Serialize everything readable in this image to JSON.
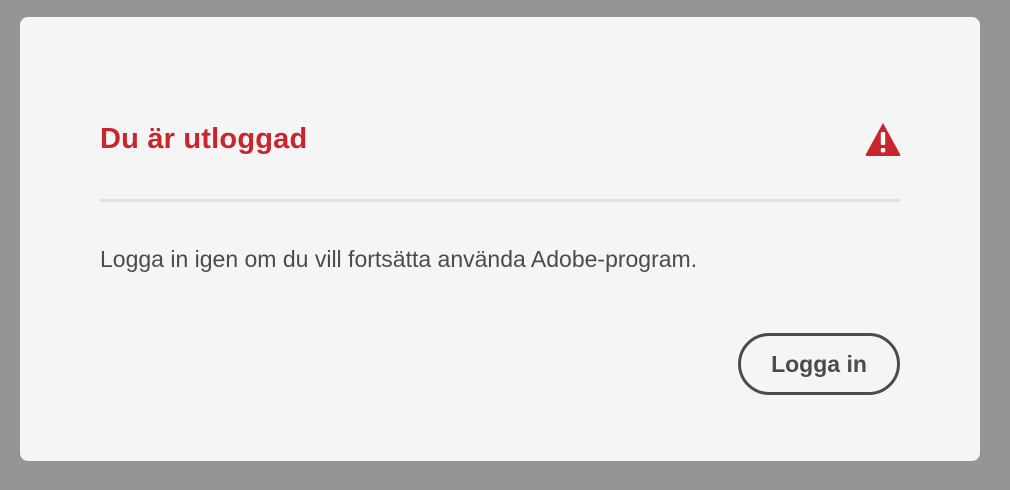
{
  "dialog": {
    "title": "Du är utloggad",
    "message": "Logga in igen om du vill fortsätta använda Adobe-program.",
    "login_label": "Logga in",
    "header_icon": "alert-triangle-icon"
  },
  "colors": {
    "backdrop": "#959595",
    "dialog_background": "#f5f5f5",
    "title": "#c9252d",
    "text": "#4b4b4b",
    "divider": "#e1e1e1"
  }
}
